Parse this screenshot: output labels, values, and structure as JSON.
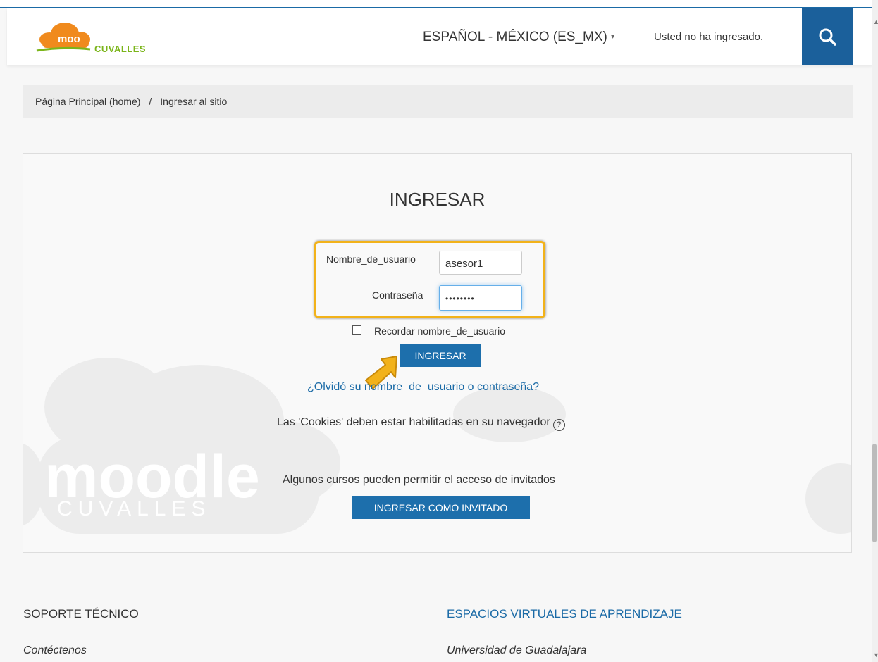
{
  "header": {
    "logo_alt": "moo",
    "logo_text": "CUVALLES",
    "language_label": "ESPAÑOL - MÉXICO (ES_MX)",
    "language_caret": "▾",
    "login_status": "Usted no ha ingresado.",
    "search_icon": "search-icon"
  },
  "breadcrumb": {
    "home": "Página Principal (home)",
    "separator": "/",
    "current": "Ingresar al sitio"
  },
  "login": {
    "title": "INGRESAR",
    "username_label": "Nombre_de_usuario",
    "username_value": "asesor1",
    "password_label": "Contraseña",
    "password_mask": "••••••••",
    "remember_label": "Recordar nombre_de_usuario",
    "remember_checked": false,
    "submit_label": "INGRESAR",
    "forgot_link": "¿Olvidó su nombre_de_usuario o contraseña?",
    "cookies_notice": "Las 'Cookies' deben estar habilitadas en su navegador",
    "help_icon_glyph": "?",
    "guest_notice": "Algunos cursos pueden permitir el acceso de invitados",
    "guest_button": "INGRESAR COMO INVITADO"
  },
  "background": {
    "watermark_word": "moodle",
    "watermark_sub": "CUVALLES"
  },
  "footer": {
    "col1_title": "SOPORTE TÉCNICO",
    "col1_item": "Contéctenos",
    "col2_title": "ESPACIOS VIRTUALES DE APRENDIZAJE",
    "col2_item": "Universidad de Guadalajara"
  },
  "colors": {
    "brand_blue": "#1b609b",
    "button_blue": "#1d6fac",
    "link_blue": "#1a6aa6",
    "highlight_orange": "#f2b21a",
    "logo_green": "#7bb51a",
    "logo_orange": "#f08a1d"
  }
}
